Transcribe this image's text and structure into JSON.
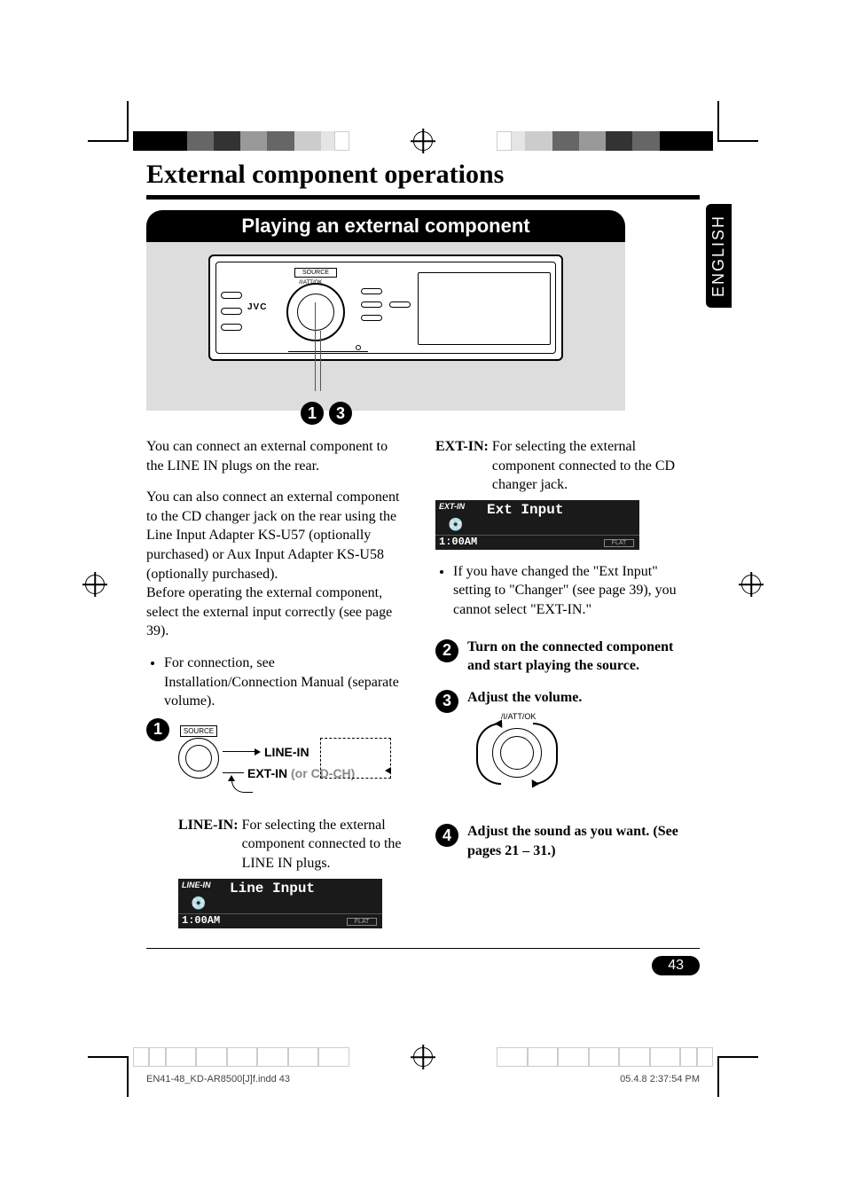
{
  "header": {
    "main_title": "External component operations",
    "section_banner": "Playing an external component",
    "language_tab": "ENGLISH"
  },
  "diagram": {
    "faceplate_brand": "JVC",
    "source_button_label": "SOURCE",
    "att_label": "/I/ATT/OK",
    "callout_1": "1",
    "callout_3": "3"
  },
  "left_column": {
    "para1": "You can connect an external component to the LINE IN plugs on the rear.",
    "para2": "You can also connect an external component to the CD changer jack on the rear using the Line Input Adapter KS-U57 (optionally purchased) or Aux Input Adapter KS-U58 (optionally purchased).",
    "para3": "Before operating the external component, select the external input correctly (see page 39).",
    "bullet1": "For connection, see Installation/Connection Manual (separate volume).",
    "step1_num": "1",
    "source_diagram": {
      "knob_label": "SOURCE",
      "label_linein": "LINE-IN",
      "label_extin": "EXT-IN",
      "label_cdch": " (or CD-CH)"
    },
    "linein_def_term": "LINE-IN:",
    "linein_def": "For selecting the external component connected to the LINE IN plugs.",
    "lcd_linein": {
      "top_label": "LINE-IN",
      "input_text": "Line Input",
      "time": "1:00AM",
      "flat": "FLAT"
    }
  },
  "right_column": {
    "extin_def_term": "EXT-IN:",
    "extin_def": "For selecting the external component connected to the CD changer jack.",
    "lcd_extin": {
      "top_label": "EXT-IN",
      "input_text": "Ext Input",
      "time": "1:00AM",
      "flat": "FLAT"
    },
    "bullet_ext": "If you have changed the \"Ext Input\" setting to \"Changer\" (see page 39), you cannot select \"EXT-IN.\"",
    "step2_num": "2",
    "step2_text": "Turn on the connected component and start playing the source.",
    "step3_num": "3",
    "step3_text": "Adjust the volume.",
    "vol_label": "/I/ATT/OK",
    "step4_num": "4",
    "step4_text": "Adjust the sound as you want. (See pages 21 – 31.)"
  },
  "footer": {
    "page_number": "43",
    "print_file": "EN41-48_KD-AR8500[J]f.indd   43",
    "print_timestamp": "05.4.8   2:37:54 PM"
  }
}
